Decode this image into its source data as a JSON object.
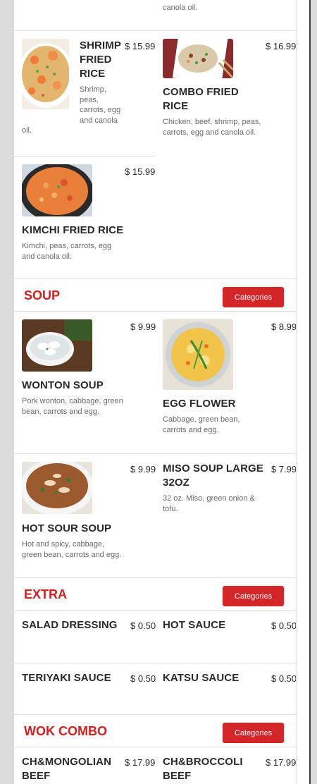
{
  "top_item": {
    "desc_tail": "canola oil."
  },
  "fried_rice": {
    "items": [
      {
        "name": "SHRIMP FRIED RICE",
        "name_lines": [
          "SHRIMP",
          "FRIED",
          "RICE"
        ],
        "price": "$ 15.99",
        "desc_lines": [
          "Shrimp,",
          "peas,",
          "carrots, egg",
          "and canola"
        ],
        "desc_tail": "oil.",
        "image": "shrimp-fried-rice-photo"
      },
      {
        "name": "COMBO FRIED RICE",
        "name_lines": [
          "COMBO FRIED",
          "RICE"
        ],
        "price": "$ 16.99",
        "desc_lines": [
          "Chicken, beef, shrimp, peas,",
          "carrots, egg and canola oil."
        ],
        "image": "combo-fried-rice-photo"
      },
      {
        "name": "KIMCHI FRIED RICE",
        "price": "$ 15.99",
        "desc_lines": [
          "Kimchi, peas, carrots, egg",
          "and canola oil."
        ],
        "image": "kimchi-fried-rice-photo"
      }
    ]
  },
  "soup": {
    "title": "SOUP",
    "categories_label": "Categories",
    "items": [
      {
        "name": "WONTON SOUP",
        "price": "$ 9.99",
        "desc_lines": [
          "Pork wonton, cabbage, green",
          "bean, carrots and egg."
        ],
        "image": "wonton-soup-photo"
      },
      {
        "name": "EGG FLOWER",
        "price": "$ 8.99",
        "desc_lines": [
          "Cabbage, green bean,",
          "carrots and egg."
        ],
        "image": "egg-flower-soup-photo"
      },
      {
        "name": "HOT SOUR SOUP",
        "price": "$ 9.99",
        "desc_lines": [
          "Hot and spicy, cabbage,",
          "green bean, carrots and egg."
        ],
        "image": "hot-sour-soup-photo"
      },
      {
        "name": "MISO SOUP LARGE 32OZ",
        "name_lines": [
          "MISO SOUP LARGE",
          "32OZ"
        ],
        "price": "$ 7.99",
        "desc_lines": [
          "32 oz. Miso, green onion &",
          "tofu."
        ]
      }
    ]
  },
  "extra": {
    "title": "EXTRA",
    "categories_label": "Categories",
    "items": [
      {
        "name": "SALAD DRESSING",
        "price": "$ 0.50"
      },
      {
        "name": "HOT SAUCE",
        "price": "$ 0.50"
      },
      {
        "name": "TERIYAKI SAUCE",
        "price": "$ 0.50"
      },
      {
        "name": "KATSU SAUCE",
        "price": "$ 0.50"
      }
    ]
  },
  "wok_combo": {
    "title": "WOK COMBO",
    "categories_label": "Categories",
    "items": [
      {
        "name": "CH&MONGOLIAN BEEF",
        "name_lines": [
          "CH&MONGOLIAN",
          "BEEF"
        ],
        "price": "$ 17.99"
      },
      {
        "name": "CH&BROCCOLI BEEF",
        "name_lines": [
          "CH&BROCCOLI",
          "BEEF"
        ],
        "price": "$ 17.99"
      }
    ]
  },
  "colors": {
    "accent": "#d52020",
    "button": "#d42628",
    "divider": "#e3e3e3",
    "text": "#2a2a2a",
    "muted": "#6a6a6a"
  }
}
